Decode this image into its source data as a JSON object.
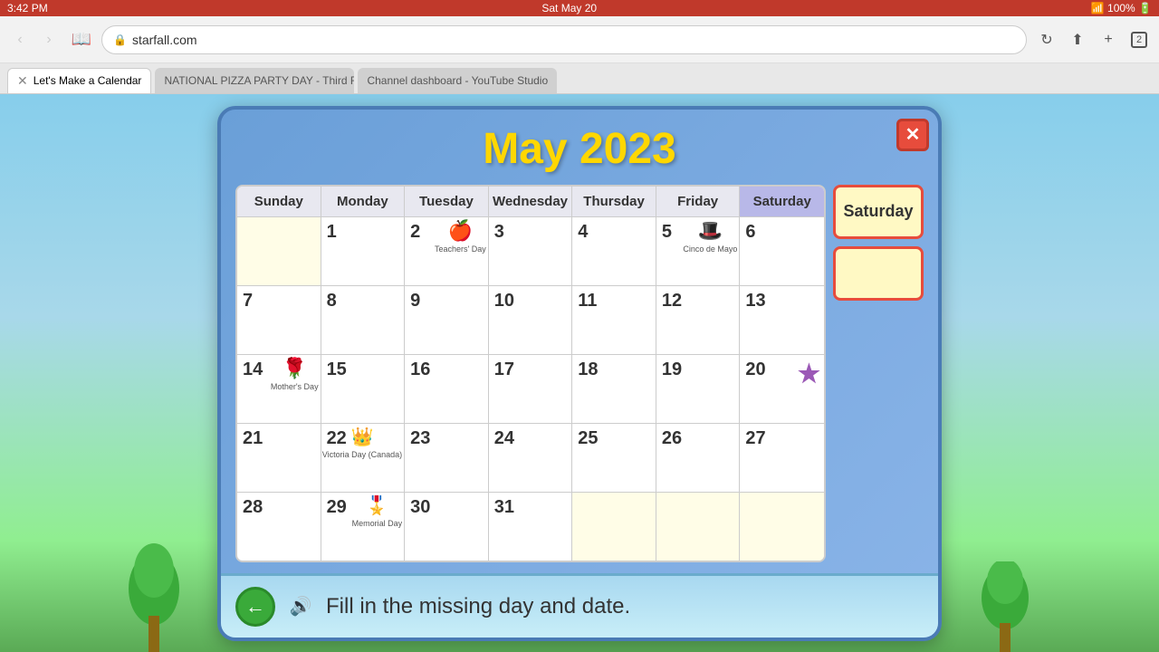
{
  "statusBar": {
    "time": "3:42 PM",
    "date": "Sat May 20",
    "wifi": "WiFi",
    "battery": "100%"
  },
  "browser": {
    "url": "starfall.com",
    "tabs": [
      {
        "label": "Let's Make a Calendar",
        "active": true
      },
      {
        "label": "NATIONAL PIZZA PARTY DAY - Third Friday in May -...",
        "active": false
      },
      {
        "label": "Channel dashboard - YouTube Studio",
        "active": false
      }
    ]
  },
  "calendar": {
    "title": "May 2023",
    "closeButton": "✕",
    "headers": [
      "Sunday",
      "Monday",
      "Tuesday",
      "Wednesday",
      "Thursday",
      "Friday",
      "Saturday"
    ],
    "days": [
      {
        "date": "",
        "emoji": "",
        "label": "",
        "empty": true
      },
      {
        "date": "1",
        "emoji": "",
        "label": ""
      },
      {
        "date": "2",
        "emoji": "🍎",
        "label": "Teachers' Day"
      },
      {
        "date": "3",
        "emoji": "",
        "label": ""
      },
      {
        "date": "4",
        "emoji": "",
        "label": ""
      },
      {
        "date": "5",
        "emoji": "🎩",
        "label": "Cinco de Mayo"
      },
      {
        "date": "6",
        "emoji": "",
        "label": ""
      },
      {
        "date": "7",
        "emoji": "",
        "label": ""
      },
      {
        "date": "8",
        "emoji": "",
        "label": ""
      },
      {
        "date": "9",
        "emoji": "",
        "label": ""
      },
      {
        "date": "10",
        "emoji": "",
        "label": ""
      },
      {
        "date": "11",
        "emoji": "",
        "label": ""
      },
      {
        "date": "12",
        "emoji": "",
        "label": ""
      },
      {
        "date": "13",
        "emoji": "",
        "label": ""
      },
      {
        "date": "14",
        "emoji": "🌹",
        "label": "Mother's Day"
      },
      {
        "date": "15",
        "emoji": "",
        "label": ""
      },
      {
        "date": "16",
        "emoji": "",
        "label": ""
      },
      {
        "date": "17",
        "emoji": "",
        "label": ""
      },
      {
        "date": "18",
        "emoji": "",
        "label": ""
      },
      {
        "date": "19",
        "emoji": "",
        "label": ""
      },
      {
        "date": "20",
        "emoji": "⭐",
        "label": "",
        "star": true
      },
      {
        "date": "21",
        "emoji": "",
        "label": ""
      },
      {
        "date": "22",
        "emoji": "👑",
        "label": "Victoria Day (Canada)"
      },
      {
        "date": "23",
        "emoji": "",
        "label": ""
      },
      {
        "date": "24",
        "emoji": "",
        "label": ""
      },
      {
        "date": "25",
        "emoji": "",
        "label": ""
      },
      {
        "date": "26",
        "emoji": "",
        "label": ""
      },
      {
        "date": "27",
        "emoji": "",
        "label": ""
      },
      {
        "date": "28",
        "emoji": "",
        "label": ""
      },
      {
        "date": "29",
        "emoji": "🎖️",
        "label": "Memorial Day"
      },
      {
        "date": "30",
        "emoji": "",
        "label": ""
      },
      {
        "date": "31",
        "emoji": "",
        "label": ""
      },
      {
        "date": "",
        "emoji": "",
        "label": "",
        "empty": true
      },
      {
        "date": "",
        "emoji": "",
        "label": "",
        "empty": true
      },
      {
        "date": "",
        "emoji": "",
        "label": "",
        "empty": true
      }
    ],
    "sidebar": {
      "day": "Saturday",
      "emptyBox": ""
    },
    "instruction": "Fill in the missing day and date.",
    "highlightedHeader": 6
  }
}
